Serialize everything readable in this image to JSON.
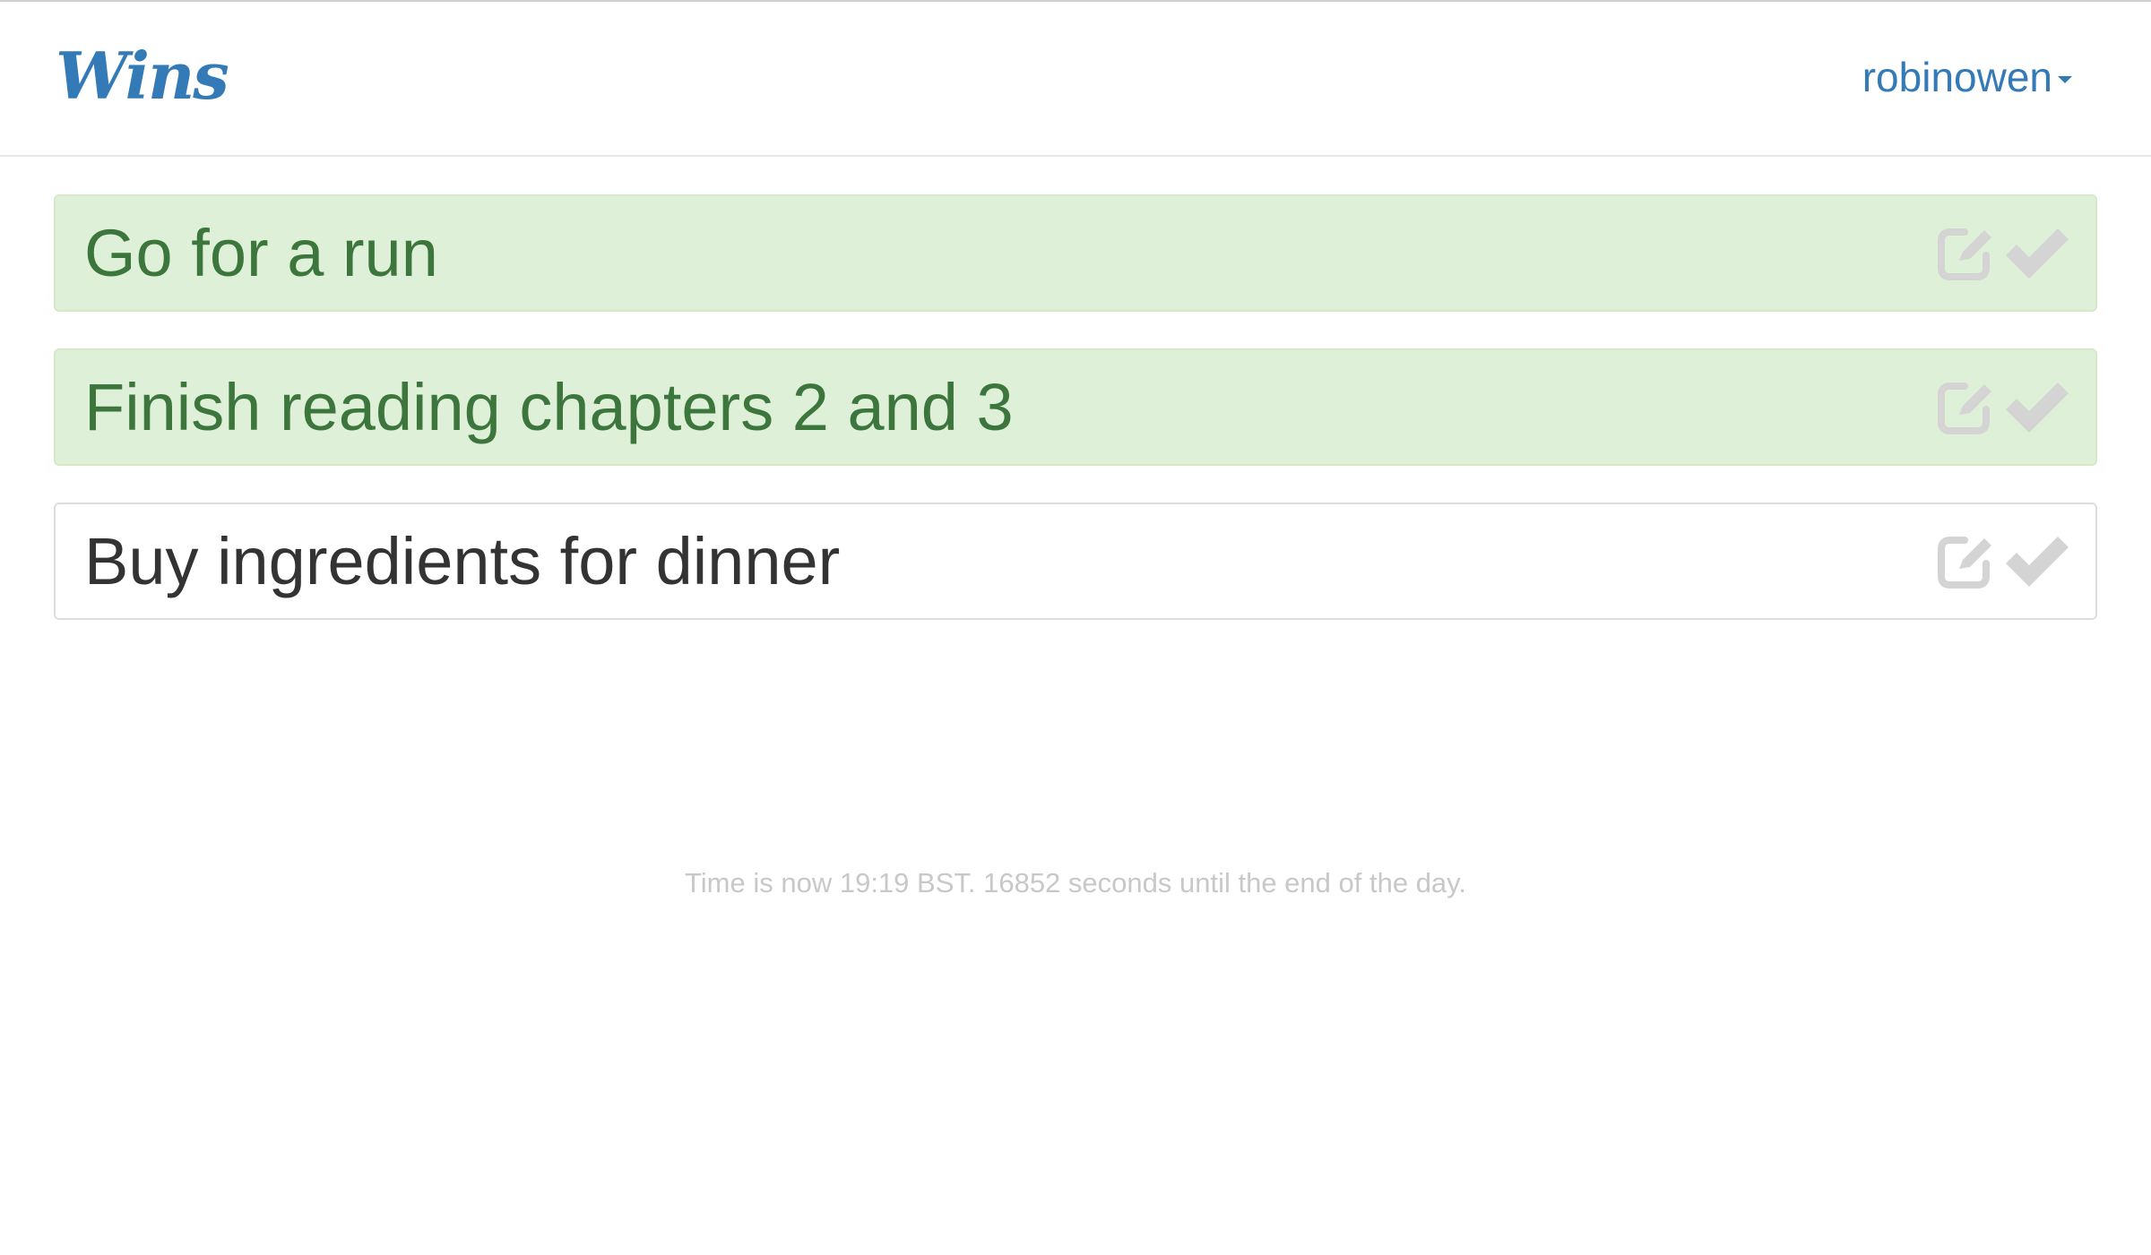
{
  "app": {
    "brand": "Wins"
  },
  "user_menu": {
    "username": "robinowen"
  },
  "wins": [
    {
      "label": "Go for a run",
      "status": "completed"
    },
    {
      "label": "Finish reading chapters 2 and 3",
      "status": "completed"
    },
    {
      "label": "Buy ingredients for dinner",
      "status": "pending"
    }
  ],
  "icons": {
    "edit": "edit-icon",
    "complete": "check-icon"
  },
  "footer": {
    "time_note": "Time is now 19:19 BST. 16852 seconds until the end of the day."
  },
  "colors": {
    "brand": "#337ab7",
    "completed_bg": "#dff0d8",
    "completed_text": "#3c763d",
    "pending_text": "#333333",
    "icon": "#d4d4d4"
  }
}
